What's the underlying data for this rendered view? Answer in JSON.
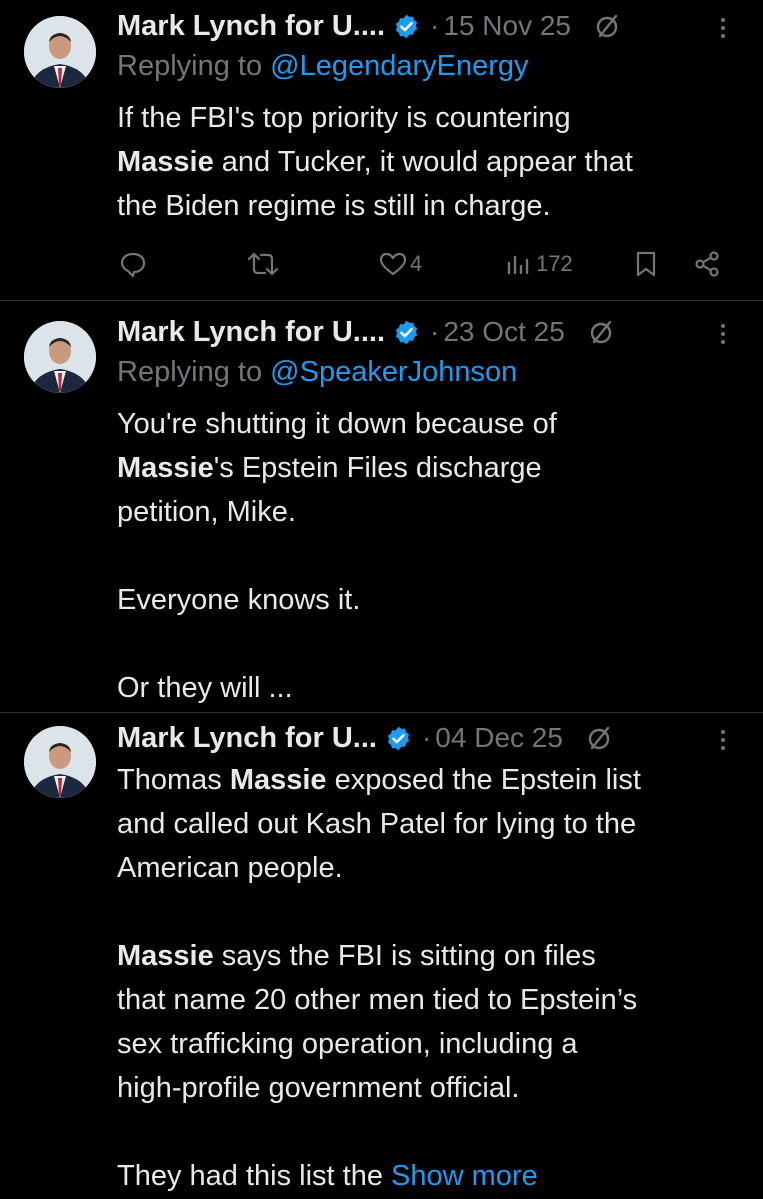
{
  "tweets": [
    {
      "author": "Mark Lynch for U....",
      "date": "15 Nov 25",
      "reply_prefix": "Replying to",
      "reply_handle": "@LegendaryEnergy",
      "text": [
        [
          {
            "t": "If the FBI's top priority is countering ",
            "b": false
          }
        ],
        [
          {
            "t": "Massie",
            "b": true
          },
          {
            "t": " and Tucker, it would appear that",
            "b": false
          }
        ],
        [
          {
            "t": "the Biden regime is still in charge.",
            "b": false
          }
        ]
      ],
      "actions": {
        "reply_count": "",
        "retweet_count": "",
        "like_count": "4",
        "view_count": "172"
      }
    },
    {
      "author": "Mark Lynch for U....",
      "date": "23 Oct 25",
      "reply_prefix": "Replying to",
      "reply_handle": "@SpeakerJohnson",
      "text": [
        [
          {
            "t": "You're shutting it down because of",
            "b": false
          }
        ],
        [
          {
            "t": "Massie",
            "b": true
          },
          {
            "t": "'s Epstein Files discharge",
            "b": false
          }
        ],
        [
          {
            "t": "petition, Mike.",
            "b": false
          }
        ],
        [],
        [
          {
            "t": "Everyone knows it.",
            "b": false
          }
        ],
        [],
        [
          {
            "t": "Or they will ...",
            "b": false
          }
        ]
      ]
    },
    {
      "author": "Mark Lynch for U...",
      "date": "04 Dec 25",
      "text": [
        [
          {
            "t": "Thomas ",
            "b": false
          },
          {
            "t": "Massie",
            "b": true
          },
          {
            "t": " exposed the Epstein list",
            "b": false
          }
        ],
        [
          {
            "t": "and called out Kash Patel for lying to the",
            "b": false
          }
        ],
        [
          {
            "t": "American people.",
            "b": false
          }
        ],
        [],
        [
          {
            "t": "Massie",
            "b": true
          },
          {
            "t": " says the FBI is sitting on files",
            "b": false
          }
        ],
        [
          {
            "t": "that name 20 other men tied to Epstein’s",
            "b": false
          }
        ],
        [
          {
            "t": "sex trafficking operation, including a",
            "b": false
          }
        ],
        [
          {
            "t": "high-profile government official.",
            "b": false
          }
        ],
        [],
        [
          {
            "t": "They had this list the ",
            "b": false
          }
        ]
      ],
      "show_more": "Show more"
    }
  ],
  "colors": {
    "background": "#000000",
    "text": "#e7e9ea",
    "muted": "#71767b",
    "link": "#1d9bf0",
    "separator": "#2f3336"
  },
  "icons": [
    "avatar",
    "verified-badge-icon",
    "grok-icon",
    "more-options-icon",
    "reply-icon",
    "retweet-icon",
    "like-icon",
    "views-icon",
    "bookmark-icon",
    "share-icon"
  ]
}
